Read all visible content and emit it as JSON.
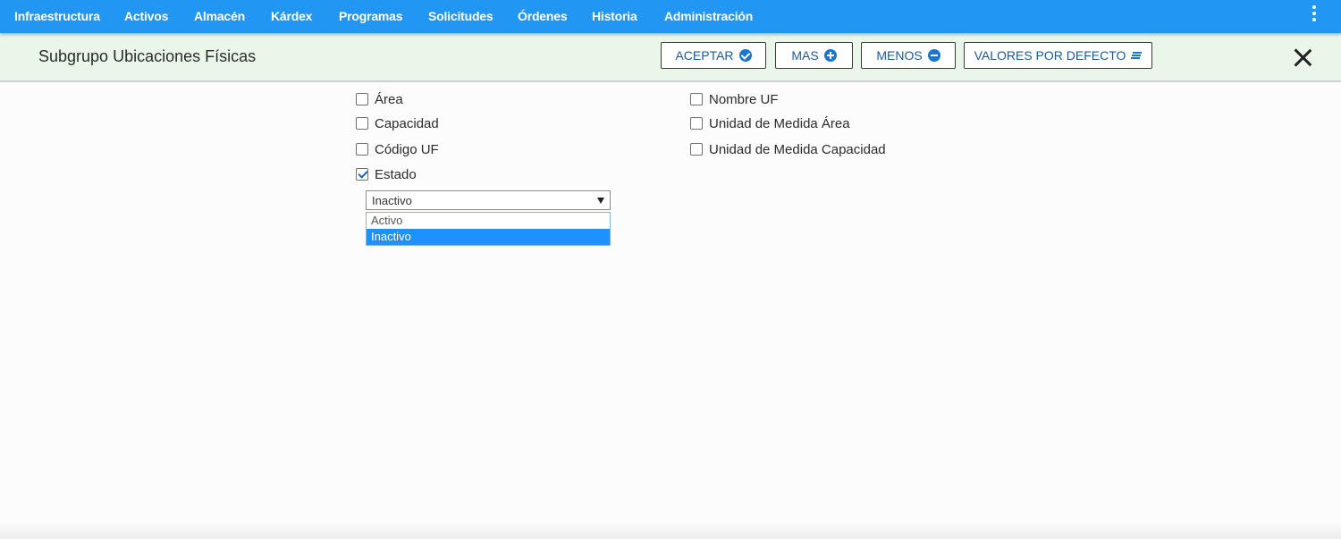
{
  "menu": {
    "items": [
      {
        "label": "Infraestructura"
      },
      {
        "label": "Activos"
      },
      {
        "label": "Almacén"
      },
      {
        "label": "Kárdex"
      },
      {
        "label": "Programas"
      },
      {
        "label": "Solicitudes"
      },
      {
        "label": "Órdenes"
      },
      {
        "label": "Historia"
      },
      {
        "label": "Administración"
      }
    ],
    "more_icon": "more-vertical-icon",
    "color": "#2196f3"
  },
  "toolbar": {
    "title": "Subgrupo Ubicaciones Físicas",
    "buttons": [
      {
        "label": "ACEPTAR",
        "icon": "check-circle-icon"
      },
      {
        "label": "MAS",
        "icon": "plus-circle-icon"
      },
      {
        "label": "MENOS",
        "icon": "minus-circle-icon"
      },
      {
        "label": "VALORES POR DEFECTO",
        "icon": "lines-icon"
      }
    ],
    "close_icon": "close-icon",
    "background": "#ebf6ea"
  },
  "fields": {
    "left": [
      {
        "label": "Área",
        "checked": false
      },
      {
        "label": "Capacidad",
        "checked": false
      },
      {
        "label": "Código UF",
        "checked": false
      },
      {
        "label": "Estado",
        "checked": true
      }
    ],
    "right": [
      {
        "label": "Nombre UF",
        "checked": false
      },
      {
        "label": "Unidad de Medida Área",
        "checked": false
      },
      {
        "label": "Unidad de Medida Capacidad",
        "checked": false
      }
    ]
  },
  "estado_select": {
    "value": "Inactivo",
    "options": [
      {
        "label": "Activo",
        "selected": false
      },
      {
        "label": "Inactivo",
        "selected": true
      }
    ],
    "highlight_color": "#1e90ff"
  }
}
